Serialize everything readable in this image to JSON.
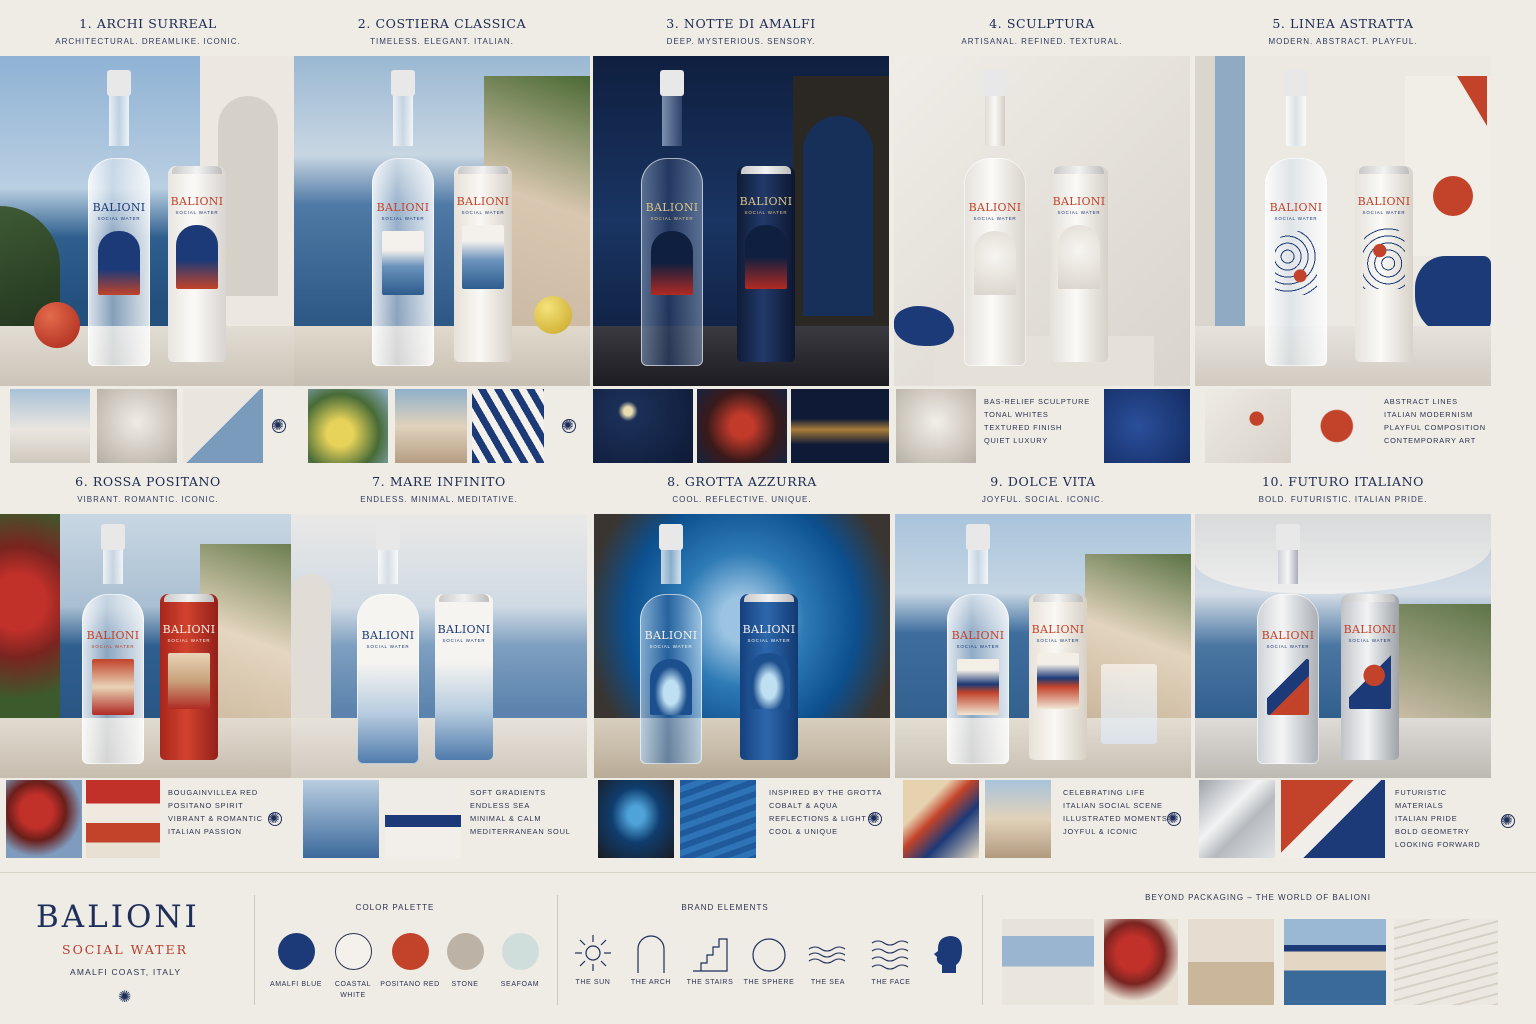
{
  "concepts": [
    {
      "number": "1.",
      "title": "ARCHI SURREAL",
      "subtitle": "ARCHITECTURAL. DREAMLIKE. ICONIC.",
      "notes": []
    },
    {
      "number": "2.",
      "title": "COSTIERA CLASSICA",
      "subtitle": "TIMELESS. ELEGANT. ITALIAN.",
      "notes": []
    },
    {
      "number": "3.",
      "title": "NOTTE DI AMALFI",
      "subtitle": "DEEP. MYSTERIOUS. SENSORY.",
      "notes": []
    },
    {
      "number": "4.",
      "title": "SCULPTURA",
      "subtitle": "ARTISANAL. REFINED. TEXTURAL.",
      "notes": [
        "BAS-RELIEF SCULPTURE",
        "TONAL WHITES",
        "TEXTURED FINISH",
        "QUIET LUXURY"
      ]
    },
    {
      "number": "5.",
      "title": "LINEA ASTRATTA",
      "subtitle": "MODERN. ABSTRACT. PLAYFUL.",
      "notes": [
        "ABSTRACT LINES",
        "ITALIAN MODERNISM",
        "PLAYFUL COMPOSITION",
        "CONTEMPORARY ART"
      ]
    },
    {
      "number": "6.",
      "title": "ROSSA POSITANO",
      "subtitle": "VIBRANT. ROMANTIC. ICONIC.",
      "notes": [
        "BOUGAINVILLEA RED",
        "POSITANO SPIRIT",
        "VIBRANT & ROMANTIC",
        "ITALIAN PASSION"
      ]
    },
    {
      "number": "7.",
      "title": "MARE INFINITO",
      "subtitle": "ENDLESS. MINIMAL. MEDITATIVE.",
      "notes": [
        "SOFT GRADIENTS",
        "ENDLESS SEA",
        "MINIMAL & CALM",
        "MEDITERRANEAN SOUL"
      ]
    },
    {
      "number": "8.",
      "title": "GROTTA AZZURRA",
      "subtitle": "COOL. REFLECTIVE. UNIQUE.",
      "notes": [
        "INSPIRED BY THE GROTTA",
        "COBALT & AQUA",
        "REFLECTIONS & LIGHT",
        "COOL & UNIQUE"
      ]
    },
    {
      "number": "9.",
      "title": "DOLCE VITA",
      "subtitle": "JOYFUL. SOCIAL. ICONIC.",
      "notes": [
        "CELEBRATING LIFE",
        "ITALIAN SOCIAL SCENE",
        "ILLUSTRATED MOMENTS",
        "JOYFUL & ICONIC"
      ]
    },
    {
      "number": "10.",
      "title": "FUTURO ITALIANO",
      "subtitle": "BOLD. FUTURISTIC. ITALIAN PRIDE.",
      "notes": [
        "FUTURISTIC MATERIALS",
        "ITALIAN PRIDE",
        "BOLD GEOMETRY",
        "LOOKING FORWARD"
      ]
    }
  ],
  "product": {
    "brand": "BALIONI",
    "tagline": "SOCIAL WATER"
  },
  "footer": {
    "brand": "BALIONI",
    "tagline": "SOCIAL WATER",
    "location": "AMALFI COAST, ITALY",
    "palette_title": "COLOR PALETTE",
    "palette": [
      {
        "name": "AMALFI BLUE",
        "color": "#1c3a78"
      },
      {
        "name": "COASTAL WHITE",
        "color": "#f4f1ec"
      },
      {
        "name": "POSITANO RED",
        "color": "#c2432a"
      },
      {
        "name": "STONE",
        "color": "#bcb2a6"
      },
      {
        "name": "SEAFOAM",
        "color": "#cfdedb"
      }
    ],
    "elements_title": "BRAND ELEMENTS",
    "elements": [
      {
        "name": "THE SUN",
        "icon": "sun-icon"
      },
      {
        "name": "THE ARCH",
        "icon": "arch-icon"
      },
      {
        "name": "THE STAIRS",
        "icon": "stairs-icon"
      },
      {
        "name": "THE SPHERE",
        "icon": "sphere-icon"
      },
      {
        "name": "THE SEA",
        "icon": "sea-icon"
      },
      {
        "name": "THE FACE",
        "icon": "face-icon"
      }
    ],
    "world_title": "BEYOND PACKAGING – THE WORLD OF BALIONI"
  },
  "colors": {
    "navy": "#1e2f5a",
    "red": "#b3402c",
    "paper": "#efebe5"
  }
}
